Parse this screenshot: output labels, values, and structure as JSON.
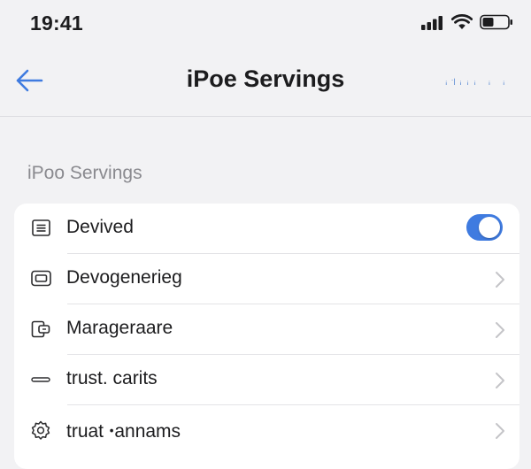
{
  "status_bar": {
    "time": "19:41",
    "icons": [
      "signal-icon",
      "wifi-icon",
      "battery-icon"
    ]
  },
  "nav": {
    "back_icon": "back-arrow-icon",
    "title": "iPoe Servings",
    "right_text": "ꜟ꜉ꜟꜟꜟ ꜟ ꜟ"
  },
  "section": {
    "header": "iPoo Servings"
  },
  "rows": [
    {
      "label": "Devived",
      "icon": "list-icon",
      "accessory": "toggle",
      "toggle_on": true
    },
    {
      "label": "Devogenerieg",
      "icon": "device-icon",
      "accessory": "chevron"
    },
    {
      "label": "Marageraare",
      "icon": "manage-icon",
      "accessory": "chevron"
    },
    {
      "label": "trust. carits",
      "icon": "line-icon",
      "accessory": "chevron"
    },
    {
      "label": "truat ꞏannams",
      "icon": "gear-icon",
      "accessory": "chevron"
    }
  ],
  "colors": {
    "accent": "#3f7be0",
    "background": "#f2f2f4",
    "card": "#ffffff",
    "secondary_text": "#8a8a8f"
  }
}
